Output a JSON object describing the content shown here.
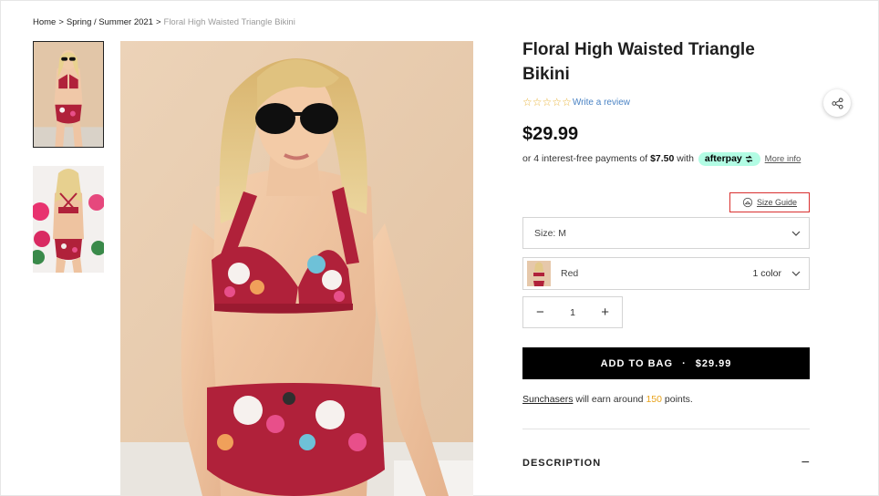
{
  "breadcrumb": {
    "home": "Home",
    "separator": ">",
    "collection": "Spring / Summer 2021",
    "current": "Floral High Waisted Triangle Bikini"
  },
  "product": {
    "title": "Floral High Waisted Triangle Bikini",
    "rating_stars": 0,
    "star_glyph": "☆",
    "write_review": "Write a review",
    "price": "$29.99"
  },
  "afterpay": {
    "prefix": "or 4 interest-free payments of",
    "amount": "$7.50",
    "with": "with",
    "badge": "afterpay",
    "more_info": "More info"
  },
  "size_guide": {
    "label": "Size Guide"
  },
  "size_select": {
    "label": "Size: M"
  },
  "color_select": {
    "label": "Red",
    "count": "1 color"
  },
  "quantity": {
    "minus": "−",
    "value": "1",
    "plus": "+"
  },
  "add_to_bag": {
    "label": "ADD TO BAG",
    "dot": "·",
    "price": "$29.99"
  },
  "points": {
    "brand": "Sunchasers",
    "middle": "will earn around",
    "amount": "150",
    "suffix": "points."
  },
  "description": {
    "label": "DESCRIPTION",
    "toggle": "−"
  },
  "colors": {
    "bikini_red": "#b0213a",
    "background_wall": "#e8cdb0",
    "button_black": "#000000",
    "afterpay_mint": "#b2fce4",
    "star_gold": "#e8b33a",
    "link_blue": "#4a83c4",
    "highlight_red": "#d9302f",
    "points_orange": "#e8a21a"
  },
  "icons": {
    "share": "share-icon",
    "size_guide": "hanger-icon",
    "chevron": "chevron-down-icon"
  }
}
